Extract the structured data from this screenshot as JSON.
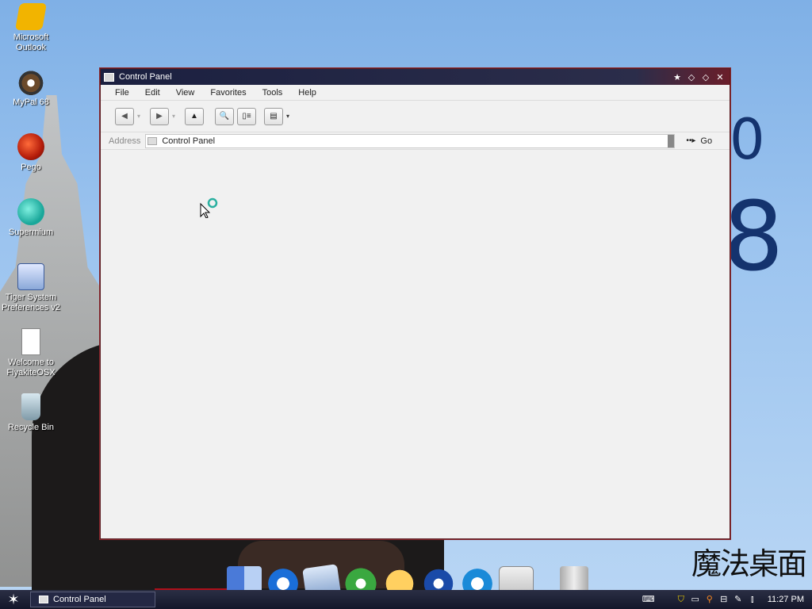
{
  "desktop": {
    "icons": [
      {
        "label": "Microsoft Outlook",
        "icon": "outlook-icon"
      },
      {
        "label": "MyPal 68",
        "icon": "mypal-icon"
      },
      {
        "label": "Pego",
        "icon": "pego-icon"
      },
      {
        "label": "Supermium",
        "icon": "supermium-icon"
      },
      {
        "label": "Tiger System Preferences v2",
        "icon": "system-preferences-icon"
      },
      {
        "label": "Welcome to FlyakiteOSX",
        "icon": "document-icon"
      },
      {
        "label": "Recycle Bin",
        "icon": "recycle-bin-icon"
      }
    ],
    "wallpaper_digits": [
      "0",
      "8"
    ],
    "wallpaper_logo": "魔法桌面"
  },
  "window": {
    "title": "Control Panel",
    "menu": [
      "File",
      "Edit",
      "View",
      "Favorites",
      "Tools",
      "Help"
    ],
    "toolbar": {
      "back": "◀",
      "forward": "▶",
      "up": "▲",
      "search": "🔍",
      "folders": "▯≡",
      "views": "▤"
    },
    "address": {
      "label": "Address",
      "value": "Control Panel",
      "go_label": "Go",
      "go_icon": "••▸"
    },
    "controls": [
      "★",
      "◇",
      "◇",
      "✕"
    ]
  },
  "dock": {
    "items": [
      "finder-icon",
      "internet-explorer-icon",
      "mail-icon",
      "itunes-icon",
      "media-player-icon",
      "imovie-icon",
      "quicktime-icon",
      "apple-icon",
      "trash-icon"
    ]
  },
  "taskbar": {
    "start_glyph": "✶",
    "task_label": "Control Panel",
    "clock": "11:27 PM",
    "tray": {
      "keyboard": "⌨",
      "shield": "⛉",
      "monitor": "▭",
      "search": "⚲",
      "network": "⊟",
      "tools": "✎",
      "volume": "⫾"
    }
  }
}
